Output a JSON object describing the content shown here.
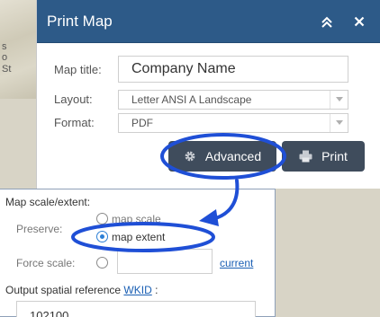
{
  "map_labels": [
    "s",
    "o",
    "St"
  ],
  "panel": {
    "title": "Print Map",
    "collapse_icon": "double-chevron-up-icon",
    "close_icon": "close-icon"
  },
  "form": {
    "map_title_label": "Map title:",
    "map_title_value": "Company Name",
    "layout_label": "Layout:",
    "layout_value": "Letter ANSI A Landscape",
    "format_label": "Format:",
    "format_value": "PDF"
  },
  "buttons": {
    "advanced_label": "Advanced",
    "print_label": "Print"
  },
  "advanced": {
    "section_title": "Map scale/extent:",
    "preserve_label": "Preserve:",
    "option_scale": "map scale",
    "option_extent": "map extent",
    "selected_option": "map extent",
    "force_scale_label": "Force scale:",
    "current_link": "current",
    "output_sr_label": "Output spatial reference",
    "wkid_link": "WKID",
    "colon": ":",
    "wkid_value": "102100"
  },
  "colors": {
    "header": "#2d5a88",
    "button": "#3f4c5c",
    "annotation": "#1f4fd6",
    "link": "#1a5fb4"
  }
}
